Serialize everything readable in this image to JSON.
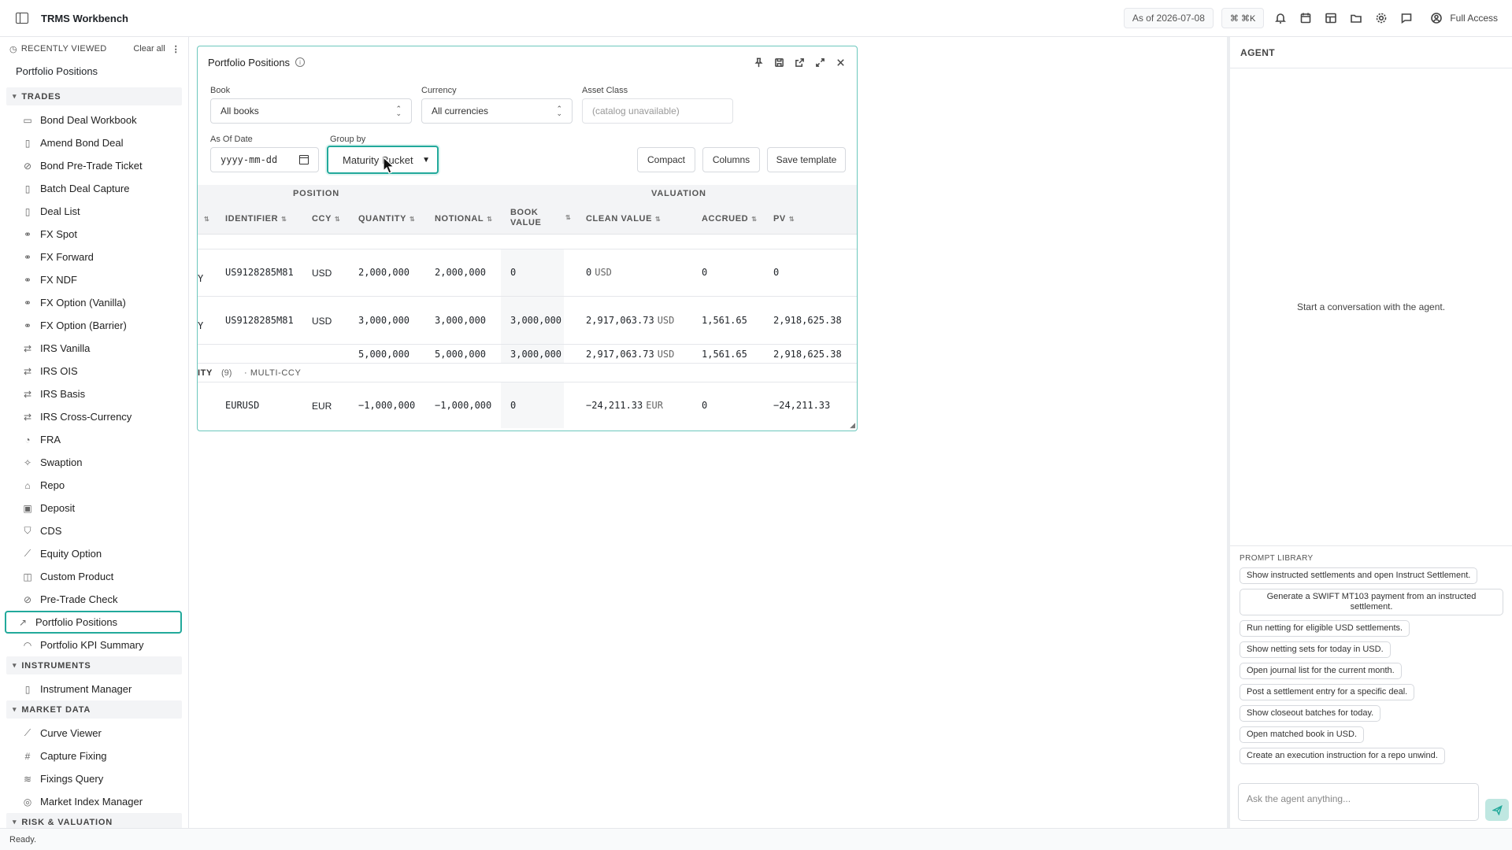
{
  "app": {
    "title": "TRMS Workbench"
  },
  "topbar": {
    "as_of": "As of 2026-07-08",
    "shortcut": "⌘ ⌘K",
    "access": "Full Access"
  },
  "sidebar": {
    "recently_viewed_label": "RECENTLY VIEWED",
    "clear_all": "Clear all",
    "recent": [
      "Portfolio Positions"
    ],
    "sections": [
      {
        "label": "TRADES",
        "items": [
          "Bond Deal Workbook",
          "Amend Bond Deal",
          "Bond Pre-Trade Ticket",
          "Batch Deal Capture",
          "Deal List",
          "FX Spot",
          "FX Forward",
          "FX NDF",
          "FX Option (Vanilla)",
          "FX Option (Barrier)",
          "IRS Vanilla",
          "IRS OIS",
          "IRS Basis",
          "IRS Cross-Currency",
          "FRA",
          "Swaption",
          "Repo",
          "Deposit",
          "CDS",
          "Equity Option",
          "Custom Product",
          "Pre-Trade Check",
          "Portfolio Positions",
          "Portfolio KPI Summary"
        ]
      },
      {
        "label": "INSTRUMENTS",
        "items": [
          "Instrument Manager"
        ]
      },
      {
        "label": "MARKET DATA",
        "items": [
          "Curve Viewer",
          "Capture Fixing",
          "Fixings Query",
          "Market Index Manager"
        ]
      },
      {
        "label": "RISK & VALUATION",
        "items": []
      }
    ],
    "active_item": "Portfolio Positions"
  },
  "panel": {
    "title": "Portfolio Positions",
    "filters": {
      "book_label": "Book",
      "book_value": "All books",
      "currency_label": "Currency",
      "currency_value": "All currencies",
      "asset_class_label": "Asset Class",
      "asset_class_value": "(catalog unavailable)",
      "as_of_label": "As Of Date",
      "as_of_placeholder": "yyyy-mm-dd",
      "group_by_label": "Group by",
      "group_by_value": "Maturity Bucket"
    },
    "buttons": {
      "compact": "Compact",
      "columns": "Columns",
      "save_template": "Save template"
    },
    "table": {
      "groups": {
        "position": "POSITION",
        "valuation": "VALUATION"
      },
      "columns": {
        "identifier": "IDENTIFIER",
        "ccy": "CCY",
        "quantity": "QUANTITY",
        "notional": "NOTIONAL",
        "book_value_1": "BOOK",
        "book_value_2": "VALUE",
        "clean_value": "CLEAN VALUE",
        "accrued": "ACCRUED",
        "pv": "PV"
      },
      "rows": [
        {
          "lead": "Y",
          "identifier": "US9128285M81",
          "ccy": "USD",
          "quantity": "2,000,000",
          "notional": "2,000,000",
          "book_value": "0",
          "clean_value": "0",
          "clean_ccy": "USD",
          "accrued": "0",
          "pv": "0"
        },
        {
          "lead": "Y",
          "identifier": "US9128285M81",
          "ccy": "USD",
          "quantity": "3,000,000",
          "notional": "3,000,000",
          "book_value": "3,000,000",
          "clean_value": "2,917,063.73",
          "clean_ccy": "USD",
          "accrued": "1,561.65",
          "pv": "2,918,625.38"
        }
      ],
      "subtotal": {
        "quantity": "5,000,000",
        "notional": "5,000,000",
        "book_value": "3,000,000",
        "clean_value": "2,917,063.73",
        "clean_ccy": "USD",
        "accrued": "1,561.65",
        "pv": "2,918,625.38"
      },
      "group_row": {
        "label": "ITY",
        "count": "(9)",
        "tag": "· MULTI-CCY"
      },
      "rows2": [
        {
          "identifier": "EURUSD",
          "ccy": "EUR",
          "quantity": "−1,000,000",
          "notional": "−1,000,000",
          "book_value": "0",
          "clean_value": "−24,211.33",
          "clean_ccy": "EUR",
          "accrued": "0",
          "pv": "−24,211.33"
        }
      ]
    }
  },
  "agent": {
    "title": "AGENT",
    "empty": "Start a conversation with the agent.",
    "prompt_library_label": "PROMPT LIBRARY",
    "prompts": [
      "Show instructed settlements and open Instruct Settlement.",
      "Generate a SWIFT MT103 payment from an instructed settlement.",
      "Run netting for eligible USD settlements.",
      "Show netting sets for today in USD.",
      "Open journal list for the current month.",
      "Post a settlement entry for a specific deal.",
      "Show closeout batches for today.",
      "Open matched book in USD.",
      "Create an execution instruction for a repo unwind."
    ],
    "input_placeholder": "Ask the agent anything..."
  },
  "status": {
    "text": "Ready."
  },
  "colors": {
    "accent": "#22a99b",
    "panel_border": "#6cc7bd"
  }
}
